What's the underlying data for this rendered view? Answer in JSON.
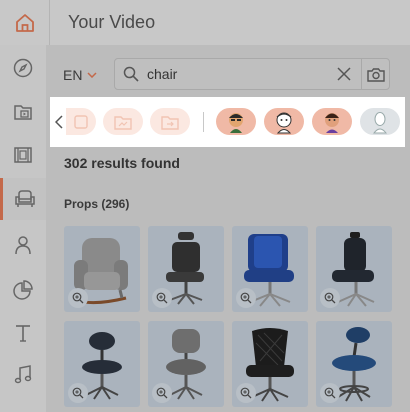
{
  "app": {
    "title": "Your Video"
  },
  "search": {
    "language": "EN",
    "query": "chair"
  },
  "results": {
    "count_text": "302 results found"
  },
  "sections": [
    {
      "label": "Props (296)"
    }
  ],
  "sidebar": {
    "items": [
      {
        "icon": "compass-icon"
      },
      {
        "icon": "media-library-icon"
      },
      {
        "icon": "film-icon"
      },
      {
        "icon": "chair-icon",
        "active": true
      },
      {
        "icon": "person-icon"
      },
      {
        "icon": "pie-chart-icon"
      },
      {
        "icon": "text-icon"
      },
      {
        "icon": "music-icon"
      }
    ]
  },
  "colors": {
    "accent": "#c4694a",
    "card_bg": "#aab3bd",
    "highlight": "#ffffff"
  }
}
